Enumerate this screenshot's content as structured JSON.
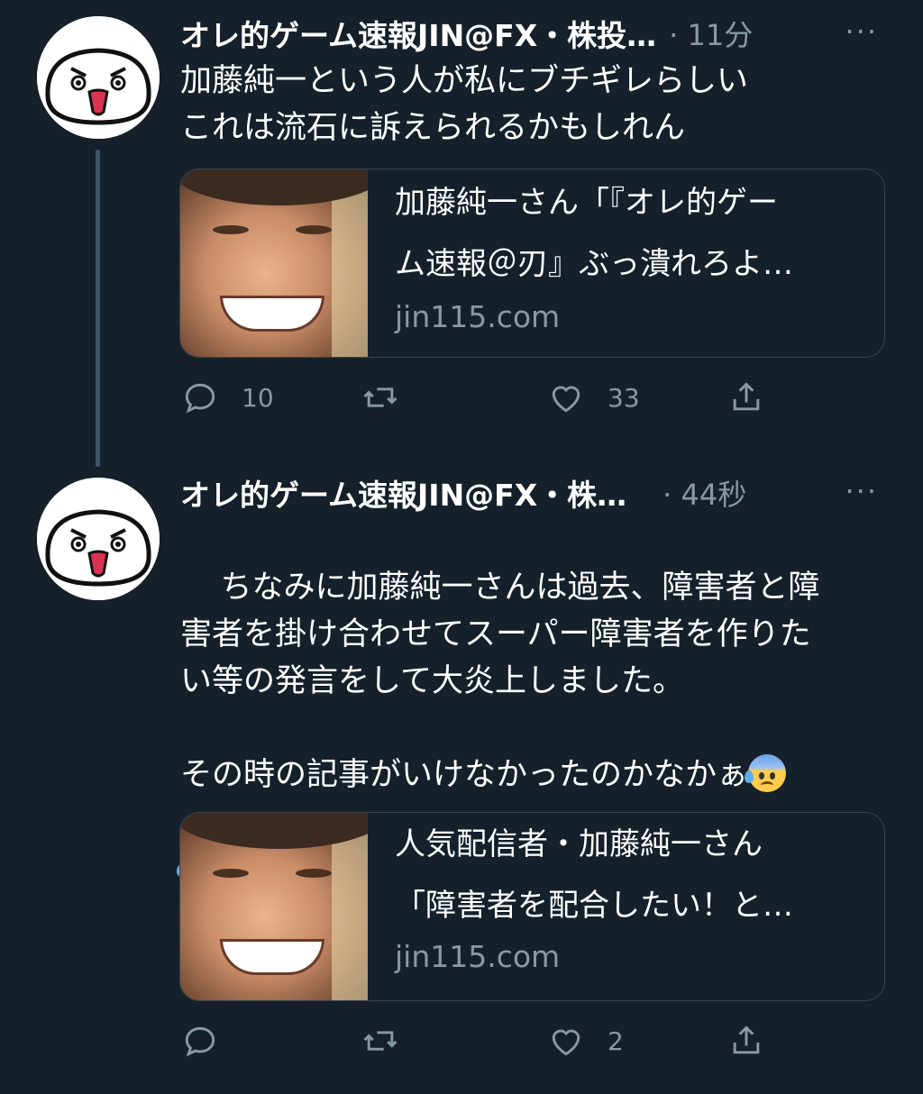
{
  "tweets": [
    {
      "name": "オレ的ゲーム速報JIN@FX・株投…",
      "time": "· 11分",
      "more": "···",
      "text": "加藤純一という人が私にブチギレらしい\nこれは流石に訴えられるかもしれん",
      "card": {
        "title_line1": "加藤純一さん「『オレ的ゲー",
        "title_line2": "ム速報＠刃』ぶっ潰れろよ…",
        "domain": "jin115.com"
      },
      "actions": {
        "reply_count": "10",
        "retweet_count": "",
        "like_count": "33"
      }
    },
    {
      "name": "オレ的ゲーム速報JIN@FX・株…",
      "time": "· 44秒",
      "more": "···",
      "text": "ちなみに加藤純一さんは過去、障害者と障\n害者を掛け合わせてスーパー障害者を作りた\nい等の発言をして大炎上しました。\n\nその時の記事がいけなかったのかなかぁ",
      "card": {
        "title_line1": "人気配信者・加藤純一さん",
        "title_line2": "「障害者を配合したい！と…",
        "domain": "jin115.com"
      },
      "actions": {
        "reply_count": "",
        "retweet_count": "",
        "like_count": "2"
      }
    }
  ],
  "colors": {
    "background": "#15202b",
    "muted": "#8899a6",
    "border": "#38444d",
    "thread_line": "#3d5466"
  },
  "icons": [
    "reply-icon",
    "retweet-icon",
    "like-icon",
    "share-icon",
    "anxious-face-with-sweat-icon"
  ]
}
